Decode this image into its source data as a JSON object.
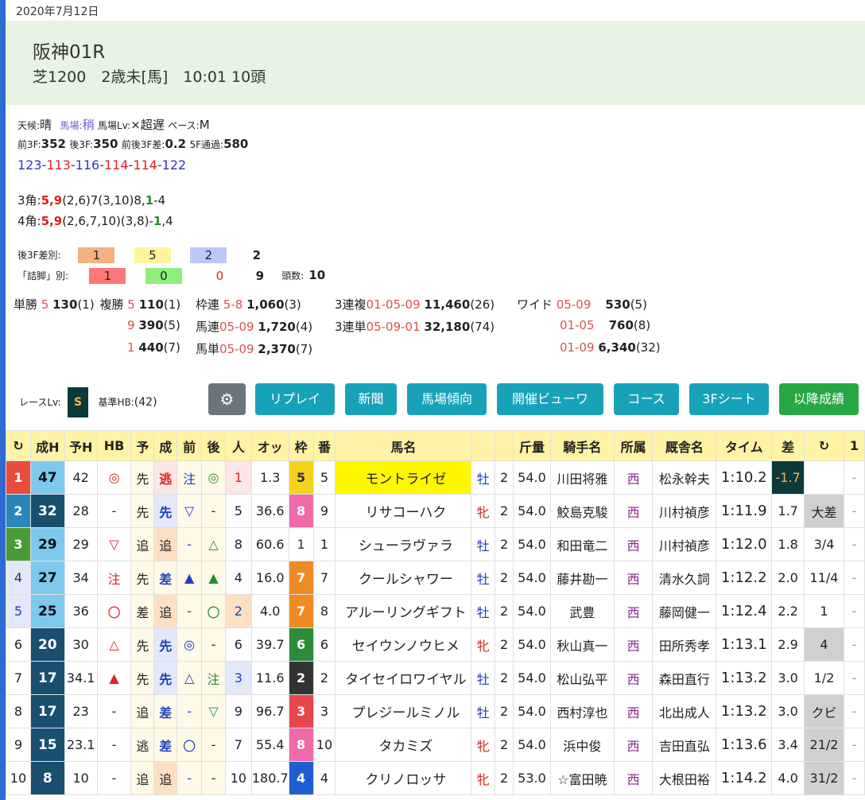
{
  "date": "2020年7月12日",
  "race": {
    "name": "阪神01R",
    "info": "芝1200　2歳未[馬]　10:01 10頭"
  },
  "conditions": {
    "weather_label": "天候:",
    "weather": "晴",
    "track_label": "馬場:",
    "track": "稍",
    "track_level_label": "馬場Lv:",
    "track_level": "×超遅",
    "pace_label": "ペース:",
    "pace": "M",
    "front3f_label": "前3F:",
    "front3f": "352",
    "back3f_label": "後3F:",
    "back3f": "350",
    "diff_label": "前後3F差:",
    "diff": "0.2",
    "f5_label": "5F通過:",
    "f5": "580"
  },
  "laps": [
    {
      "text": "123",
      "color": "#2b35c8"
    },
    {
      "text": "-",
      "color": "#2b35c8"
    },
    {
      "text": "113",
      "color": "#e02020"
    },
    {
      "text": "-",
      "color": "#2b35c8"
    },
    {
      "text": "116",
      "color": "#2b35c8"
    },
    {
      "text": "-",
      "color": "#2b35c8"
    },
    {
      "text": "114",
      "color": "#e02020"
    },
    {
      "text": "-",
      "color": "#2b35c8"
    },
    {
      "text": "114",
      "color": "#e02020"
    },
    {
      "text": "-",
      "color": "#2b35c8"
    },
    {
      "text": "122",
      "color": "#2b35c8"
    }
  ],
  "corners": {
    "c3_label": "3角:",
    "c3_lead": "5,9",
    "c3_mid": "(2,6)7(3,10)8,",
    "c3_one": "1",
    "c3_tail": "-4",
    "c4_label": "4角:",
    "c4_lead": "5,9",
    "c4_mid": "(2,6,7,10)(3,8)-",
    "c4_one": "1",
    "c4_tail": ",4"
  },
  "diffs": {
    "back3f_label": "後3F差別:",
    "back3f_vals": [
      "1",
      "5",
      "2",
      "2"
    ],
    "tsume_label": "「詰脚」別:",
    "tsume_vals": [
      "1",
      "0",
      "0",
      "9"
    ],
    "heads_label": "頭数:",
    "heads": "10"
  },
  "payouts": {
    "tansho_label": "単勝",
    "tansho_num": "5",
    "tansho_val": "130",
    "tansho_pop": "(1)",
    "fukusho_label": "複勝",
    "fukusho": [
      {
        "num": "5",
        "val": "110",
        "pop": "(1)"
      },
      {
        "num": "9",
        "val": "390",
        "pop": "(5)"
      },
      {
        "num": "1",
        "val": "440",
        "pop": "(7)"
      }
    ],
    "wakuren_label": "枠連",
    "wakuren_num": "5-8",
    "wakuren_val": "1,060",
    "wakuren_pop": "(3)",
    "umaren_label": "馬連",
    "umaren_num": "05-09",
    "umaren_val": "1,720",
    "umaren_pop": "(4)",
    "umatan_label": "馬単",
    "umatan_num": "05-09",
    "umatan_val": "2,370",
    "umatan_pop": "(7)",
    "sanpuku_label": "3連複",
    "sanpuku_num": "01-05-09",
    "sanpuku_val": "11,460",
    "sanpuku_pop": "(26)",
    "santan_label": "3連単",
    "santan_num": "05-09-01",
    "santan_val": "32,180",
    "santan_pop": "(74)",
    "wide_label": "ワイド",
    "wide": [
      {
        "num": "05-09",
        "val": "530",
        "pop": "(5)"
      },
      {
        "num": "01-05",
        "val": "760",
        "pop": "(8)"
      },
      {
        "num": "01-09",
        "val": "6,340",
        "pop": "(32)"
      }
    ]
  },
  "race_level": {
    "label": "レースLv:",
    "grade": "S",
    "base_label": "基準HB:",
    "base": "(42)"
  },
  "buttons": {
    "replay": "リプレイ",
    "newspaper": "新聞",
    "track_trend": "馬場傾向",
    "meet_viewer": "開催ビューワ",
    "course": "コース",
    "sheet3f": "3Fシート",
    "after": "以降成績"
  },
  "columns": [
    "↻",
    "成H",
    "予H",
    "HB",
    "予",
    "成",
    "前",
    "後",
    "人",
    "オッ",
    "枠",
    "番",
    "馬名",
    "",
    "",
    "斤量",
    "騎手名",
    "所属",
    "厩舎名",
    "タイム",
    "差",
    "↻",
    "1"
  ],
  "rows": [
    {
      "rank": "1",
      "seiH": "47",
      "yoH": "42",
      "hb": "◎",
      "yo": "先",
      "sei": "逃",
      "mae": "注",
      "ato": "◎",
      "pop": "1",
      "odds": "1.3",
      "waku": "5",
      "ban": "5",
      "name": "モントライゼ",
      "sex": "牡",
      "age": "2",
      "kin": "54.0",
      "jockey": "川田将雅",
      "area": "西",
      "stable": "松永幹夫",
      "time": "1:10.2",
      "diff": "-1.7",
      "margin": ""
    },
    {
      "rank": "2",
      "seiH": "32",
      "yoH": "28",
      "hb": "-",
      "yo": "先",
      "sei": "先",
      "mae": "▽",
      "ato": "-",
      "pop": "5",
      "odds": "36.6",
      "waku": "8",
      "ban": "9",
      "name": "リサコーハク",
      "sex": "牝",
      "age": "2",
      "kin": "54.0",
      "jockey": "鮫島克駿",
      "area": "西",
      "stable": "川村禎彦",
      "time": "1:11.9",
      "diff": "1.7",
      "margin": "大差"
    },
    {
      "rank": "3",
      "seiH": "29",
      "yoH": "29",
      "hb": "▽",
      "yo": "追",
      "sei": "追",
      "mae": "-",
      "ato": "△",
      "pop": "8",
      "odds": "60.6",
      "waku": "1",
      "ban": "1",
      "name": "シューラヴァラ",
      "sex": "牡",
      "age": "2",
      "kin": "54.0",
      "jockey": "和田竜二",
      "area": "西",
      "stable": "川村禎彦",
      "time": "1:12.0",
      "diff": "1.8",
      "margin": "3/4"
    },
    {
      "rank": "4",
      "seiH": "27",
      "yoH": "34",
      "hb": "注",
      "yo": "先",
      "sei": "差",
      "mae": "▲",
      "ato": "▲",
      "pop": "4",
      "odds": "16.0",
      "waku": "7",
      "ban": "7",
      "name": "クールシャワー",
      "sex": "牡",
      "age": "2",
      "kin": "54.0",
      "jockey": "藤井勘一",
      "area": "西",
      "stable": "清水久詞",
      "time": "1:12.2",
      "diff": "2.0",
      "margin": "11/4"
    },
    {
      "rank": "5",
      "seiH": "25",
      "yoH": "36",
      "hb": "〇",
      "yo": "差",
      "sei": "追",
      "mae": "-",
      "ato": "〇",
      "pop": "2",
      "odds": "4.0",
      "waku": "7",
      "ban": "8",
      "name": "アルーリングギフト",
      "sex": "牡",
      "age": "2",
      "kin": "54.0",
      "jockey": "武豊",
      "area": "西",
      "stable": "藤岡健一",
      "time": "1:12.4",
      "diff": "2.2",
      "margin": "1"
    },
    {
      "rank": "6",
      "seiH": "20",
      "yoH": "30",
      "hb": "△",
      "yo": "先",
      "sei": "先",
      "mae": "◎",
      "ato": "-",
      "pop": "6",
      "odds": "39.7",
      "waku": "6",
      "ban": "6",
      "name": "セイウンノウヒメ",
      "sex": "牝",
      "age": "2",
      "kin": "54.0",
      "jockey": "秋山真一",
      "area": "西",
      "stable": "田所秀孝",
      "time": "1:13.1",
      "diff": "2.9",
      "margin": "4"
    },
    {
      "rank": "7",
      "seiH": "17",
      "yoH": "34.1",
      "hb": "▲",
      "yo": "先",
      "sei": "先",
      "mae": "△",
      "ato": "注",
      "pop": "3",
      "odds": "11.6",
      "waku": "2",
      "ban": "2",
      "name": "タイセイロワイヤル",
      "sex": "牡",
      "age": "2",
      "kin": "54.0",
      "jockey": "松山弘平",
      "area": "西",
      "stable": "森田直行",
      "time": "1:13.2",
      "diff": "3.0",
      "margin": "1/2"
    },
    {
      "rank": "8",
      "seiH": "17",
      "yoH": "23",
      "hb": "-",
      "yo": "追",
      "sei": "差",
      "mae": "-",
      "ato": "▽",
      "pop": "9",
      "odds": "96.7",
      "waku": "3",
      "ban": "3",
      "name": "プレジールミノル",
      "sex": "牡",
      "age": "2",
      "kin": "54.0",
      "jockey": "西村淳也",
      "area": "西",
      "stable": "北出成人",
      "time": "1:13.2",
      "diff": "3.0",
      "margin": "クビ"
    },
    {
      "rank": "9",
      "seiH": "15",
      "yoH": "23.1",
      "hb": "-",
      "yo": "逃",
      "sei": "差",
      "mae": "〇",
      "ato": "-",
      "pop": "7",
      "odds": "55.4",
      "waku": "8",
      "ban": "10",
      "name": "タカミズ",
      "sex": "牝",
      "age": "2",
      "kin": "54.0",
      "jockey": "浜中俊",
      "area": "西",
      "stable": "吉田直弘",
      "time": "1:13.6",
      "diff": "3.4",
      "margin": "21/2"
    },
    {
      "rank": "10",
      "seiH": "8",
      "yoH": "10",
      "hb": "-",
      "yo": "追",
      "sei": "追",
      "mae": "-",
      "ato": "-",
      "pop": "10",
      "odds": "180.7",
      "waku": "4",
      "ban": "4",
      "name": "クリノロッサ",
      "sex": "牝",
      "age": "2",
      "kin": "53.0",
      "jockey": "☆富田暁",
      "area": "西",
      "stable": "大根田裕",
      "time": "1:14.2",
      "diff": "4.0",
      "margin": "31/2"
    }
  ],
  "colors": {
    "accent": "#17a2b8",
    "green_button": "#28a745",
    "gear_button": "#6c757d",
    "header_bg": "#fff3a6"
  }
}
